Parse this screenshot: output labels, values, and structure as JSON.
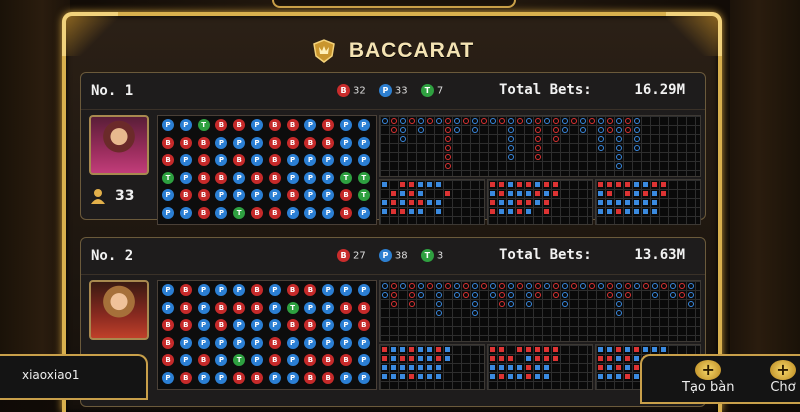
{
  "title": "BACCARAT",
  "tables": [
    {
      "number": "No. 1",
      "banker_count": "32",
      "player_count": "33",
      "tie_count": "7",
      "banker_label": "B",
      "player_label": "P",
      "tie_label": "T",
      "total_bets_label": "Total Bets:",
      "total_bets_value": "16.29M",
      "players_online": "33",
      "bead_road": [
        "P",
        "B",
        "B",
        "T",
        "P",
        "P",
        "P",
        "B",
        "P",
        "P",
        "B",
        "P",
        "T",
        "B",
        "B",
        "B",
        "B",
        "B",
        "B",
        "P",
        "P",
        "B",
        "P",
        "P",
        "B",
        "P",
        "B",
        "P",
        "P",
        "T",
        "P",
        "P",
        "P",
        "B",
        "P",
        "B",
        "B",
        "B",
        "B",
        "B",
        "P",
        "B",
        "B",
        "B",
        "P",
        "P",
        "B",
        "P",
        "P",
        "B",
        "P",
        "P",
        "P",
        "P",
        "B",
        "B",
        "P",
        "P",
        "P",
        "P",
        "P",
        "P",
        "P",
        "T",
        "B",
        "B",
        "P",
        "P",
        "P",
        "T",
        "T",
        "P"
      ]
    },
    {
      "number": "No. 2",
      "banker_count": "27",
      "player_count": "38",
      "tie_count": "3",
      "banker_label": "B",
      "player_label": "P",
      "tie_label": "T",
      "total_bets_label": "Total Bets:",
      "total_bets_value": "13.63M",
      "bead_road": [
        "P",
        "P",
        "B",
        "B",
        "B",
        "P",
        "B",
        "B",
        "B",
        "P",
        "P",
        "B",
        "P",
        "P",
        "P",
        "P",
        "B",
        "P",
        "P",
        "B",
        "B",
        "P",
        "P",
        "P",
        "P",
        "B",
        "P",
        "P",
        "T",
        "B",
        "B",
        "B",
        "P",
        "P",
        "P",
        "B",
        "P",
        "P",
        "P",
        "B",
        "B",
        "P",
        "B",
        "T",
        "B",
        "P",
        "P",
        "P",
        "B",
        "P",
        "B",
        "P",
        "B",
        "B",
        "P",
        "P",
        "P",
        "P",
        "B",
        "B",
        "P",
        "B",
        "P",
        "P",
        "B",
        "P",
        "P",
        "B",
        "B",
        "P",
        "P",
        "P"
      ]
    }
  ],
  "user": {
    "name": "xiaoxiao1"
  },
  "buttons": {
    "create_label": "Tạo bàn",
    "second_label": "Chơ"
  },
  "colors": {
    "banker": "#c62a2a",
    "player": "#2b7fd4",
    "tie": "#2ea040",
    "gold": "#d8b04e"
  },
  "icons": {
    "title": "crown-shield-icon",
    "players": "user-icon",
    "create": "plus-icon"
  }
}
